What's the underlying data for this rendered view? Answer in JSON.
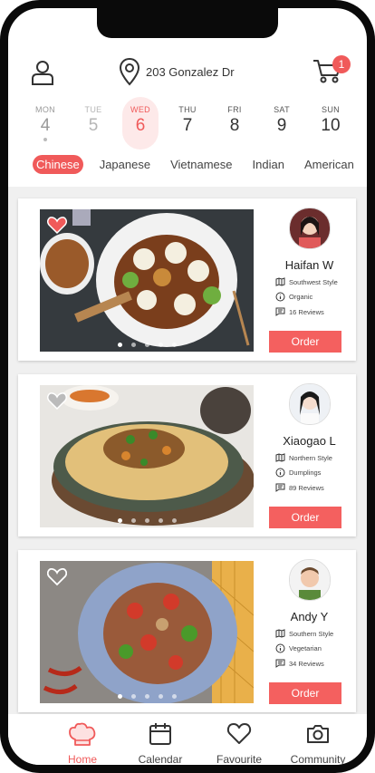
{
  "header": {
    "user_icon": "user-icon",
    "location_icon": "location-pin-icon",
    "address": "203 Gonzalez Dr",
    "cart_icon": "cart-icon",
    "cart_count": "1"
  },
  "days": [
    {
      "name": "MON",
      "num": "4"
    },
    {
      "name": "TUE",
      "num": "5"
    },
    {
      "name": "WED",
      "num": "6"
    },
    {
      "name": "THU",
      "num": "7"
    },
    {
      "name": "FRI",
      "num": "8"
    },
    {
      "name": "SAT",
      "num": "9"
    },
    {
      "name": "SUN",
      "num": "10"
    }
  ],
  "categories": [
    "Chinese",
    "Japanese",
    "Vietnamese",
    "Indian",
    "American"
  ],
  "cards": [
    {
      "chef": "Haifan W",
      "style": "Southwest Style",
      "tag": "Organic",
      "reviews": "16 Reviews",
      "order": "Order",
      "favorited": true
    },
    {
      "chef": "Xiaogao L",
      "style": "Northern Style",
      "tag": "Dumplings",
      "reviews": "89 Reviews",
      "order": "Order",
      "favorited": false
    },
    {
      "chef": "Andy Y",
      "style": "Southern Style",
      "tag": "Vegetarian",
      "reviews": "34 Reviews",
      "order": "Order",
      "favorited": false
    }
  ],
  "tabs": [
    {
      "label": "Home",
      "icon": "chef-hat-icon"
    },
    {
      "label": "Calendar",
      "icon": "calendar-icon"
    },
    {
      "label": "Favourite",
      "icon": "heart-icon"
    },
    {
      "label": "Community",
      "icon": "camera-icon"
    }
  ],
  "colors": {
    "accent": "#f05a5a",
    "order_button": "#f4605f",
    "feed_bg": "#f0f0f0"
  }
}
